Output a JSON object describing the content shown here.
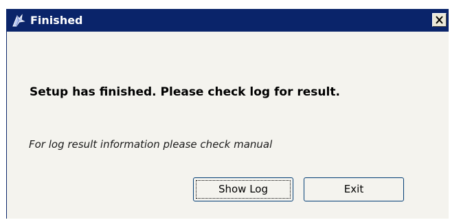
{
  "window": {
    "title": "Finished",
    "icon": "setup-wizard-icon",
    "close_icon": "close-icon"
  },
  "content": {
    "message": "Setup has finished. Please check log for result.",
    "hint": "For log result information please check manual"
  },
  "buttons": {
    "show_log": "Show Log",
    "exit": "Exit"
  },
  "colors": {
    "titlebar": "#0a246a",
    "dialog_background": "#f4f3ee",
    "button_border": "#003c74"
  }
}
